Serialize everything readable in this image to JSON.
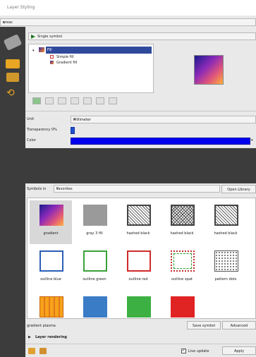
{
  "window": {
    "title": "Layer Styling"
  },
  "layer_combo": {
    "value": "areas"
  },
  "renderer_combo": {
    "value": "Single symbol"
  },
  "tree": {
    "root": "Fill",
    "children": [
      "Simple fill",
      "Gradient fill"
    ]
  },
  "props": {
    "unit_label": "Unit",
    "unit_value": "Millimeter",
    "transparency_label": "Transparency 0%",
    "color_label": "Color",
    "color_hex": "#0000ee"
  },
  "library": {
    "symbols_label": "Symbols in",
    "group_value": "Favorites",
    "open_manager": "Open Library",
    "items": [
      {
        "label": "gradient",
        "icon": "gradient-swatch"
      },
      {
        "label": "gray 3 fill",
        "icon": "gray-fill-swatch"
      },
      {
        "label": "hashed black",
        "icon": "hatch-swatch"
      },
      {
        "label": "hashed black",
        "icon": "crosshatch-swatch"
      },
      {
        "label": "hashed black",
        "icon": "hatch-swatch"
      },
      {
        "label": "outline blue",
        "icon": "outline-blue-swatch"
      },
      {
        "label": "outline green",
        "icon": "outline-green-swatch"
      },
      {
        "label": "outline red",
        "icon": "outline-red-swatch"
      },
      {
        "label": "outline xpat",
        "icon": "dotted-outline-swatch"
      },
      {
        "label": "pattern dots",
        "icon": "dot-pattern-swatch"
      },
      {
        "label": "",
        "icon": "orange-triangles-swatch"
      },
      {
        "label": "",
        "icon": "blue-fill-swatch"
      },
      {
        "label": "",
        "icon": "green-fill-swatch"
      },
      {
        "label": "",
        "icon": "red-fill-swatch"
      }
    ]
  },
  "footer": {
    "symbol_name": "gradient plasma",
    "save_symbol": "Save symbol",
    "advanced": "Advanced",
    "layer_rendering": "Layer rendering",
    "live_update": "Live update",
    "apply": "Apply"
  },
  "colors": {
    "accent_blue": "#0000ee",
    "icon_sidebar": "#3c3c3c"
  }
}
